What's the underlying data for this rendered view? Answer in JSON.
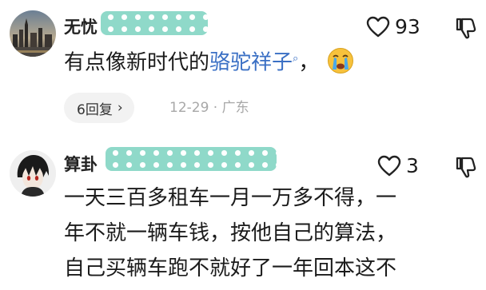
{
  "comments": [
    {
      "username": "无忧",
      "likes": "93",
      "text_before": "有点像新时代的",
      "text_highlight": "骆驼祥子",
      "text_after": "，",
      "reply_button": "6回复",
      "meta": "12-29 · 广东",
      "avatar": "city-skyline-avatar",
      "emoji": "crying-face-emoji"
    },
    {
      "username": "算卦",
      "likes": "3",
      "lines": [
        "一天三百多租车一月一万多不得，一",
        "年不就一辆车钱，按他自己的算法，",
        "自己买辆车跑不就好了一年回本这不"
      ],
      "avatar": "anime-character-avatar"
    }
  ],
  "colors": {
    "highlight": "#3a6fc4",
    "mask": "#8fd9c9",
    "meta": "#a8a8a8"
  }
}
